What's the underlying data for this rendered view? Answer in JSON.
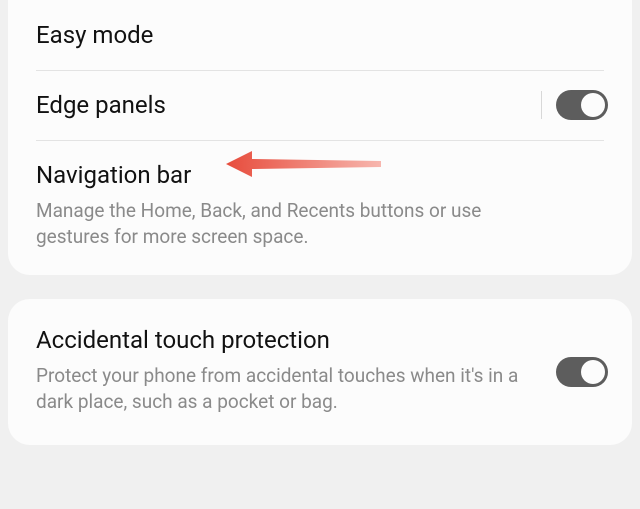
{
  "group1": {
    "items": [
      {
        "title": "Easy mode",
        "desc": null,
        "toggle": null
      },
      {
        "title": "Edge panels",
        "desc": null,
        "toggle": true
      },
      {
        "title": "Navigation bar",
        "desc": "Manage the Home, Back, and Recents buttons or use gestures for more screen space.",
        "toggle": null,
        "highlighted": true
      }
    ]
  },
  "group2": {
    "items": [
      {
        "title": "Accidental touch protection",
        "desc": "Protect your phone from accidental touches when it's in a dark place, such as a pocket or bag.",
        "toggle": true
      }
    ]
  },
  "annotation": {
    "type": "arrow",
    "points_to": "navigation-bar"
  }
}
